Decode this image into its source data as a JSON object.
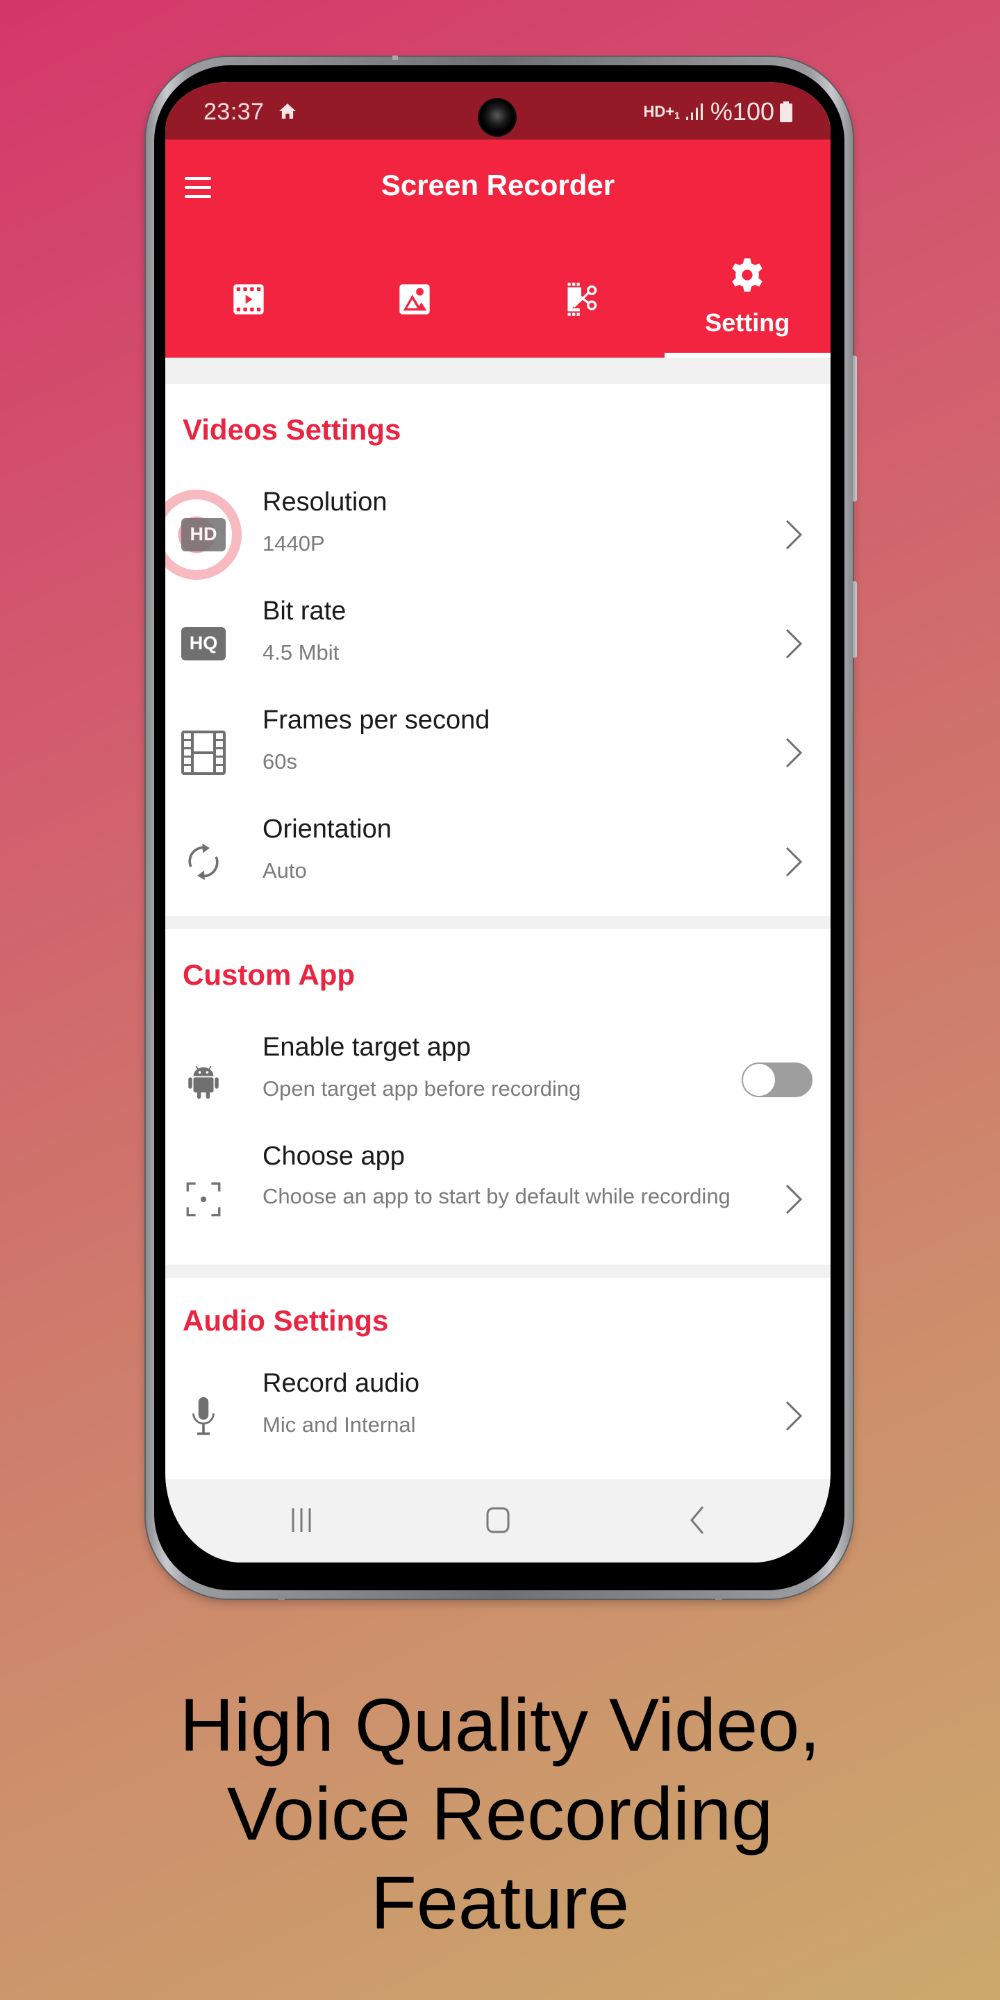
{
  "status_bar": {
    "time": "23:37",
    "home_icon": "home-icon",
    "network": "HD+",
    "network_sub": "1",
    "signal_icon": "signal-icon",
    "battery_text": "%100",
    "battery_icon": "battery-full-icon"
  },
  "app_bar": {
    "title": "Screen Recorder",
    "menu_icon": "hamburger-menu-icon"
  },
  "tabs": [
    {
      "id": "videos",
      "icon": "video-file-icon",
      "label": "",
      "active": false
    },
    {
      "id": "images",
      "icon": "image-icon",
      "label": "",
      "active": false
    },
    {
      "id": "editor",
      "icon": "video-cut-icon",
      "label": "",
      "active": false
    },
    {
      "id": "settings",
      "icon": "gear-icon",
      "label": "Setting",
      "active": true
    }
  ],
  "sections": {
    "video": {
      "title": "Videos Settings",
      "items": [
        {
          "title": "Resolution",
          "value": "1440P",
          "icon": "hd-icon",
          "icon_text": "HD"
        },
        {
          "title": "Bit rate",
          "value": "4.5 Mbit",
          "icon": "hq-icon",
          "icon_text": "HQ"
        },
        {
          "title": "Frames per second",
          "value": "60s",
          "icon": "film-strip-icon"
        },
        {
          "title": "Orientation",
          "value": "Auto",
          "icon": "rotate-icon"
        }
      ]
    },
    "custom_app": {
      "title": "Custom App",
      "items": [
        {
          "title": "Enable target app",
          "value": "Open target app before recording",
          "icon": "android-icon",
          "toggle": false
        },
        {
          "title": "Choose app",
          "value": "Choose an app to start by default while recording",
          "icon": "focus-frame-icon"
        }
      ]
    },
    "audio": {
      "title": "Audio Settings",
      "items": [
        {
          "title": "Record audio",
          "value": "Mic and Internal",
          "icon": "microphone-icon"
        }
      ]
    }
  },
  "nav_bar": {
    "recent": "recent-apps-icon",
    "home": "home-button-icon",
    "back": "back-icon"
  },
  "caption": {
    "line1": "High Quality Video,",
    "line2": "Voice Recording",
    "line3": "Feature"
  },
  "colors": {
    "accent": "#F2243F",
    "status_bar": "#951A27",
    "section_title": "#EA2441",
    "icon_gray": "#707070",
    "background_start": "#D4376A",
    "background_end": "#CBA96C"
  }
}
